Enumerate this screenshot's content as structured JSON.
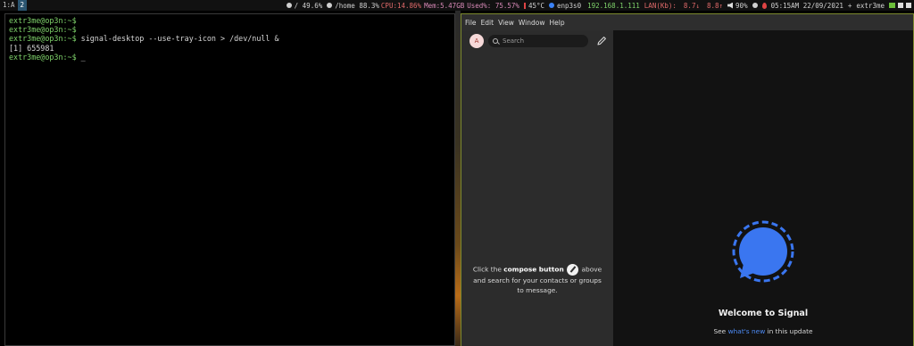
{
  "topbar": {
    "workspaces": [
      "1:A",
      "2"
    ],
    "disk_root": "/ 49.6%",
    "disk_home": "/home 88.3%",
    "cpu": "CPU:14.86%",
    "mem": "Mem:5.47GB",
    "used": "Used%: 75.57%",
    "temp": "45°C",
    "iface": "enp3s0",
    "ip": "192.168.1.111",
    "lan_label": "LAN(Kb):",
    "lan_down": "8.7↓",
    "lan_up": "8.8↑",
    "volume": "90%",
    "datetime": "05:15AM 22/09/2021",
    "plus": "+",
    "user": "extr3me",
    "colors": {
      "bar_bg": "#111111",
      "active_ws": "#2b5570",
      "green": "#7fd36b",
      "red": "#e06a6a"
    }
  },
  "terminal": {
    "lines": [
      {
        "prompt": "extr3me@op3n:~$",
        "cmd": ""
      },
      {
        "prompt": "extr3me@op3n:~$",
        "cmd": ""
      },
      {
        "prompt": "extr3me@op3n:~$",
        "cmd": " signal-desktop --use-tray-icon > /dev/null &"
      },
      {
        "prompt": "",
        "cmd": "[1] 655981"
      },
      {
        "prompt": "extr3me@op3n:~$",
        "cmd": " _"
      }
    ]
  },
  "signal": {
    "menu": [
      "File",
      "Edit",
      "View",
      "Window",
      "Help"
    ],
    "avatar_letter": "A",
    "search_placeholder": "Search",
    "empty_pre": "Click the ",
    "empty_bold": "compose button",
    "empty_post": " above and search for your contacts or groups to message.",
    "welcome_title": "Welcome to Signal",
    "whatsnew_pre": "See ",
    "whatsnew_link": "what's new",
    "whatsnew_post": " in this update",
    "icons": {
      "compose": "compose-pencil-icon",
      "logo": "signal-logo-icon",
      "search": "search-icon"
    },
    "colors": {
      "accent": "#3a76f0",
      "link": "#4d8bf5",
      "sidebar": "#2c2c2c",
      "window_border": "#7c8a2e"
    }
  }
}
